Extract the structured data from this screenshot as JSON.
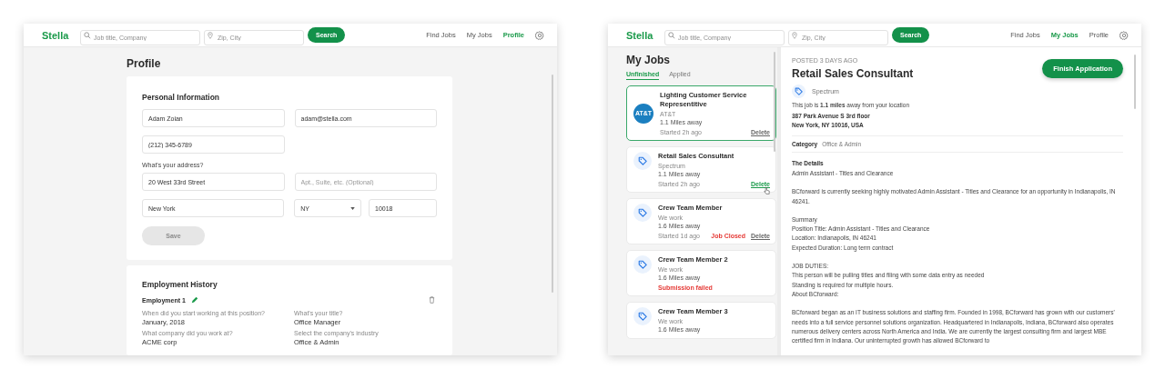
{
  "windows": [
    {
      "kind": "profile",
      "nav": {
        "logo": "Stella",
        "search_placeholder": "Job title, Company",
        "location_placeholder": "Zip, City",
        "search_button": "Search",
        "links": [
          {
            "label": "Find Jobs",
            "selected": false
          },
          {
            "label": "My Jobs",
            "selected": false
          },
          {
            "label": "Profile",
            "selected": true
          }
        ]
      },
      "profile": {
        "title": "Profile",
        "personal": {
          "heading": "Personal Information",
          "rows": [
            {
              "kind": "fields",
              "fields": [
                {
                  "kind": "input",
                  "value": "Adam Zoian"
                },
                {
                  "kind": "input",
                  "value": "adam@stella.com"
                }
              ]
            },
            {
              "kind": "fields",
              "fields": [
                {
                  "kind": "input",
                  "value": "(212) 345-6789"
                }
              ]
            },
            {
              "kind": "label",
              "text": "What's your address?"
            },
            {
              "kind": "fields",
              "fields": [
                {
                  "kind": "input",
                  "value": "20 West 33rd Street"
                },
                {
                  "kind": "input",
                  "placeholder": "Apt., Suite, etc. (Optional)"
                }
              ]
            },
            {
              "kind": "fields",
              "fields": [
                {
                  "kind": "input",
                  "value": "New York"
                },
                {
                  "kind": "select",
                  "value": "NY"
                },
                {
                  "kind": "short",
                  "value": "10018"
                }
              ]
            }
          ],
          "save": {
            "label": "Save",
            "disabled": true
          }
        },
        "employment": {
          "heading": "Employment History",
          "entry": "Employment 1",
          "answers": [
            {
              "question": "When did you start working at this position?",
              "answer": "January, 2018"
            },
            {
              "question": "What's your title?",
              "answer": "Office Manager"
            },
            {
              "question": "What company did you work at?",
              "answer": "ACME corp"
            },
            {
              "question": "Select the company's industry",
              "answer": "Office & Admin"
            }
          ]
        }
      }
    },
    {
      "kind": "my_jobs",
      "nav": {
        "logo": "Stella",
        "search_placeholder": "Job title, Company",
        "location_placeholder": "Zip, City",
        "search_button": "Search",
        "links": [
          {
            "label": "Find Jobs",
            "selected": false
          },
          {
            "label": "My Jobs",
            "selected": true
          },
          {
            "label": "Profile",
            "selected": false
          }
        ]
      },
      "list": {
        "title": "My Jobs",
        "tabs": [
          {
            "label": "Unfinished",
            "selected": true
          },
          {
            "label": "Applied",
            "selected": false
          }
        ],
        "jobs": [
          {
            "kind": "att",
            "logo_text": "AT&T",
            "title": "Lighting Customer Service Representitive",
            "company": "AT&T",
            "distance": "1.1 Miles away",
            "started": "Started 2h ago",
            "delete": "Delete",
            "delete_hover": false,
            "selected": true
          },
          {
            "kind": "tag",
            "title": "Retail Sales Consultant",
            "company": "Spectrum",
            "distance": "1.1 Miles away",
            "started": "Started 2h ago",
            "delete": "Delete",
            "delete_hover": true,
            "selected": false
          },
          {
            "kind": "tag",
            "title": "Crew Team Member",
            "company": "We work",
            "distance": "1.6 Miles away",
            "started": "Started 1d ago",
            "status": "Job Closed",
            "delete": "Delete",
            "delete_hover": false,
            "selected": false
          },
          {
            "kind": "tag",
            "title": "Crew Team Member 2",
            "company": "We work",
            "distance": "1.6 Miles away",
            "status": "Submission failed",
            "selected": false
          },
          {
            "kind": "tag",
            "title": "Crew Team Member 3",
            "company": "We work",
            "distance": "1.6 Miles away",
            "selected": false
          }
        ]
      },
      "detail": {
        "posted": "POSTED 3 DAYS AGO",
        "title": "Retail Sales Consultant",
        "button": "Finish Application",
        "company": "Spectrum",
        "distance_text": "This job is **1.1 miles** away from your location",
        "address": [
          "387 Park Avenue S 3rd floor",
          "New York, NY 10016, USA"
        ],
        "category_label": "Category",
        "category": "Office & Admin",
        "details_heading": "The Details",
        "blocks": [
          [
            "Admin Assistant - Titles and Clearance"
          ],
          [
            "BCforward is currently seeking highly motivated Admin Assistant - Titles and Clearance for an opportunity in Indianapolis, IN 46241."
          ],
          [
            "Summary",
            "Position Title: Admin Assistant - Titles and Clearance",
            "Location: Indianapolis, IN 46241",
            "Expected Duration: Long term contract"
          ],
          [
            "JOB DUTIES:",
            "This person will be pulling titles and filing with some data entry as needed",
            "Standing is required for multiple hours.",
            "About BCforward:"
          ],
          [
            "BCforward began as an IT business solutions and staffing firm. Founded in 1998, BCforward has grown with our customers' needs into a full service personnel solutions organization. Headquartered in Indianapolis, Indiana, BCforward also operates numerous delivery centers across North America and India. We are currently the largest consulting firm and largest MBE certified firm in Indiana. Our uninterrupted growth has allowed BCforward to"
          ]
        ]
      }
    }
  ]
}
